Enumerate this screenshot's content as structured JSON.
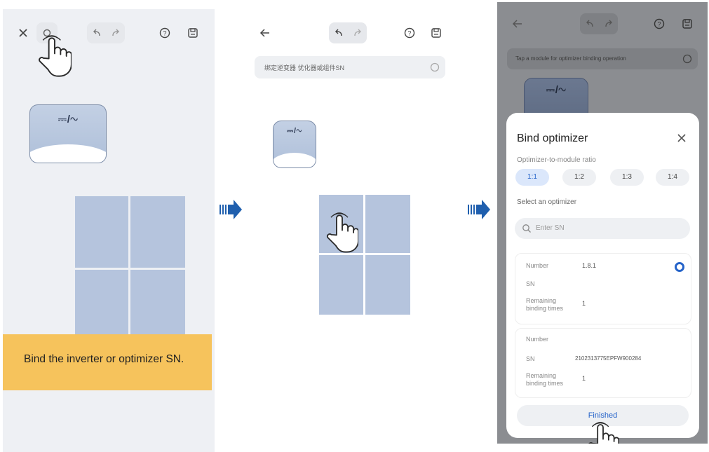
{
  "colors": {
    "accent": "#2563c9",
    "flow_arrow": "#1f5fae",
    "callout": "#f6c35c",
    "module": "#b5c4dd"
  },
  "panel1": {
    "inverter_symbol": "⎓/∿",
    "callout_text": "Bind the inverter or optimizer SN."
  },
  "panel2": {
    "hint_text": "绑定逆变器 优化器或组件SN",
    "inverter_symbol": "⎓/∿"
  },
  "panel3": {
    "hint_text": "Tap a module for optimizer binding operation",
    "inverter_symbol": "⎓/∿",
    "sheet": {
      "title": "Bind optimizer",
      "ratio_label": "Optimizer-to-module ratio",
      "ratios": [
        "1:1",
        "1:2",
        "1:3",
        "1:4"
      ],
      "select_label": "Select an optimizer",
      "search_placeholder": "Enter SN",
      "items": [
        {
          "number_label": "Number",
          "number": "1.8.1",
          "sn_label": "SN",
          "sn": "",
          "remaining_label": "Remaining binding times",
          "remaining": "1"
        },
        {
          "number_label": "Number",
          "number": "",
          "sn_label": "SN",
          "sn": "2102313775EPFW900284",
          "remaining_label": "Remaining binding times",
          "remaining": "1"
        }
      ],
      "finish_label": "Finished"
    }
  }
}
